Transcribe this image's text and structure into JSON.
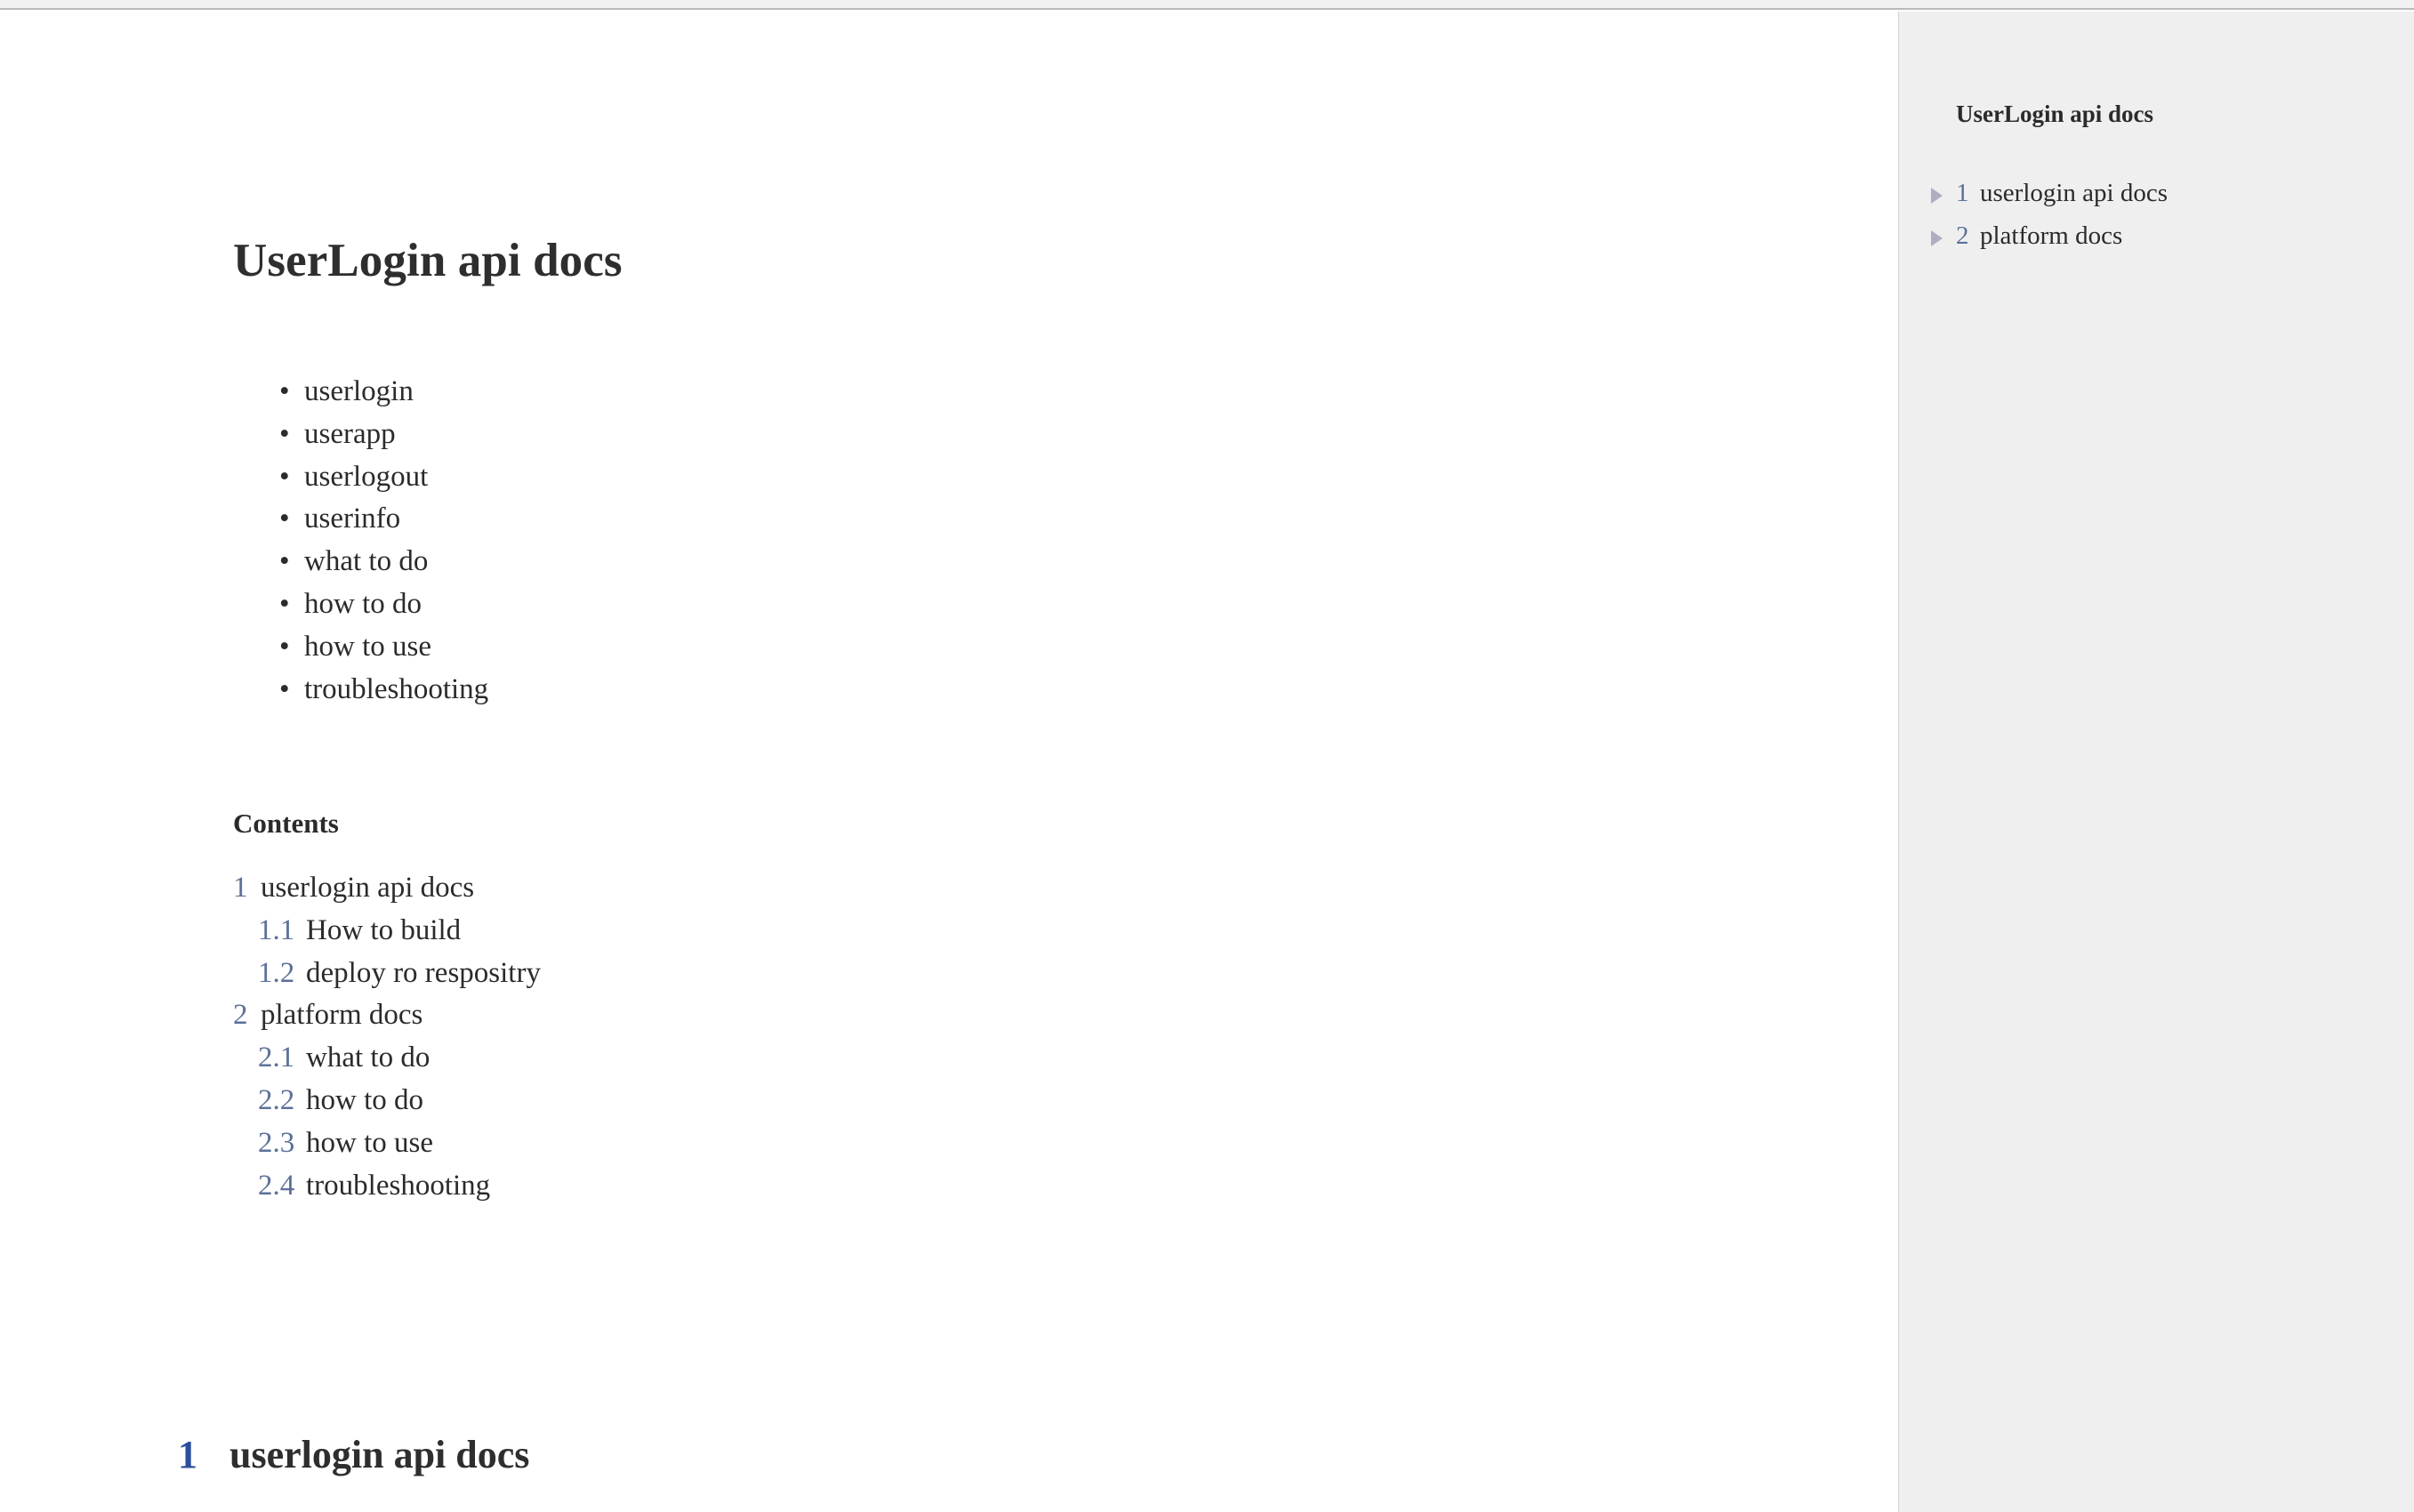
{
  "document": {
    "title": "UserLogin api docs",
    "feature_list": [
      "userlogin",
      "userapp",
      "userlogout",
      "userinfo",
      "what to do",
      "how to do",
      "how to use",
      "troubleshooting"
    ],
    "contents_heading": "Contents",
    "toc": [
      {
        "number": "1",
        "label": "userlogin api docs",
        "level": 1
      },
      {
        "number": "1.1",
        "label": "How to build",
        "level": 2
      },
      {
        "number": "1.2",
        "label": "deploy ro respositry",
        "level": 2
      },
      {
        "number": "2",
        "label": "platform docs",
        "level": 1
      },
      {
        "number": "2.1",
        "label": "what to do",
        "level": 2
      },
      {
        "number": "2.2",
        "label": "how to do",
        "level": 2
      },
      {
        "number": "2.3",
        "label": "how to use",
        "level": 2
      },
      {
        "number": "2.4",
        "label": "troubleshooting",
        "level": 2
      }
    ],
    "section_heading": {
      "number": "1",
      "label": "userlogin api docs"
    },
    "bullet_glyph": "•"
  },
  "sidebar": {
    "title": "UserLogin api docs",
    "items": [
      {
        "icon": "triangle-right-icon",
        "number": "1",
        "label": "userlogin api docs"
      },
      {
        "icon": "triangle-right-icon",
        "number": "2",
        "label": "platform docs"
      }
    ]
  },
  "colors": {
    "page_background": "#ffffff",
    "sidebar_background": "#efefef",
    "body_text": "#2b2b2b",
    "toc_number": "#5c7099",
    "section_number": "#2c4f9c",
    "triangle": "#b0adc0",
    "divider": "#d5d5d5",
    "top_strip": "#f1f1f1"
  }
}
